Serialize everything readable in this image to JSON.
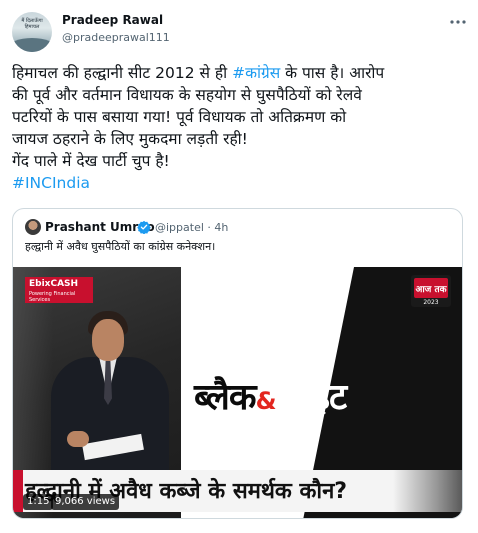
{
  "author": {
    "name": "Pradeep Rawal",
    "handle": "@pradeeprawal111",
    "avatar_text": "मैं दिलाऊँगा हिमाचल"
  },
  "tweet": {
    "line1_prefix": "हिमाचल की हल्द्वानी सीट 2012 से ही ",
    "line1_hashtag": "#कांग्रेस",
    "line1_suffix": " के पास है। आरोप",
    "line2": "की पूर्व और वर्तमान विधायक के सहयोग से घुसपैठियों को रेलवे",
    "line3": "पटरियों के पास बसाया गया! पूर्व विधायक तो अतिक्रमण को",
    "line4": "जायज ठहराने के लिए मुकदमा लड़ती रही!",
    "line5": "गेंद पाले में देख पार्टी चुप है!",
    "hashtag": "#INCIndia"
  },
  "quoted": {
    "name": "Prashant Umrao",
    "handle": "@ippatel",
    "separator": "·",
    "age": "4h",
    "text": "हल्द्वानी में अवैध घुसपैठियों का कांग्रेस कनेक्शन।"
  },
  "video": {
    "sponsor": "EbixCASH",
    "sponsor_sub": "Powering Financial Services",
    "channel": "आज तक",
    "channel_year": "2023",
    "show_title_left": "ब्लैक",
    "show_title_amp": "&",
    "show_title_right": "व्हाइट",
    "ticker": "हल्द्वानी में अवैध कब्जे के समर्थक कौन?",
    "duration": "1:15",
    "views": "9,066 views"
  },
  "icons": {
    "more": "more-horizontal-icon",
    "verified": "verified-badge-icon"
  },
  "colors": {
    "link": "#1d9bf0",
    "verified": "#1d9bf0",
    "brand_red": "#c8102e"
  }
}
